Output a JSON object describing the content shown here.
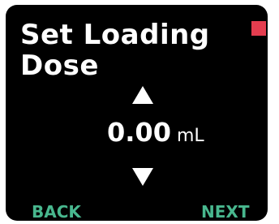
{
  "screen": {
    "title_line1": "Set Loading",
    "title_line2": "Dose",
    "dose": {
      "value": "0.00",
      "unit": "mL"
    },
    "icons": {
      "increase": "up-triangle-icon",
      "decrease": "down-triangle-icon",
      "status": "status-square-icon"
    },
    "softkeys": {
      "left_label": "BACK",
      "right_label": "NEXT"
    }
  },
  "colors": {
    "background": "#000000",
    "text": "#ffffff",
    "softkey": "#48b78e",
    "status_indicator": "#e43d4f"
  }
}
